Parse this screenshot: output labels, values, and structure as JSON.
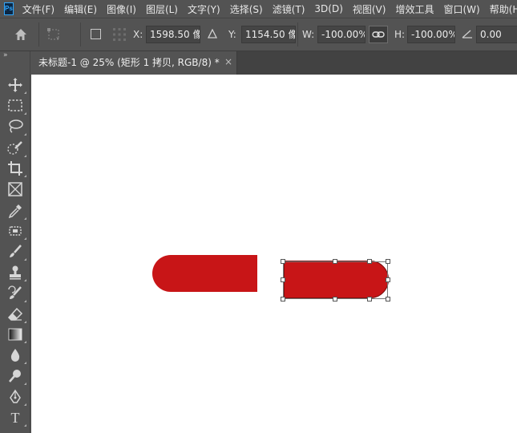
{
  "app": {
    "logo_text": "Ps",
    "menu": [
      "文件(F)",
      "编辑(E)",
      "图像(I)",
      "图层(L)",
      "文字(Y)",
      "选择(S)",
      "滤镜(T)",
      "3D(D)",
      "视图(V)",
      "增效工具",
      "窗口(W)",
      "帮助(H)"
    ]
  },
  "options": {
    "x_label": "X:",
    "x_value": "1598.50 像",
    "y_label": "Y:",
    "y_value": "1154.50 像",
    "w_label": "W:",
    "w_value": "-100.00%",
    "h_label": "H:",
    "h_value": "-100.00%",
    "angle_value": "0.00"
  },
  "document": {
    "tab_title": "未标题-1 @ 25% (矩形 1 拷贝, RGB/8) *",
    "close_symbol": "×"
  },
  "toolbar": {
    "collapse_symbol": "»",
    "tools": [
      "move-tool",
      "marquee-tool",
      "lasso-tool",
      "quick-select-tool",
      "crop-tool",
      "frame-tool",
      "eyedropper-tool",
      "healing-brush-tool",
      "brush-tool",
      "clone-stamp-tool",
      "history-brush-tool",
      "eraser-tool",
      "gradient-tool",
      "blur-tool",
      "dodge-tool",
      "pen-tool",
      "type-tool"
    ],
    "type_tool_glyph": "T"
  },
  "colors": {
    "shape_fill": "#c81517",
    "canvas_bg": "#ffffff",
    "ui_bg": "#535353"
  }
}
